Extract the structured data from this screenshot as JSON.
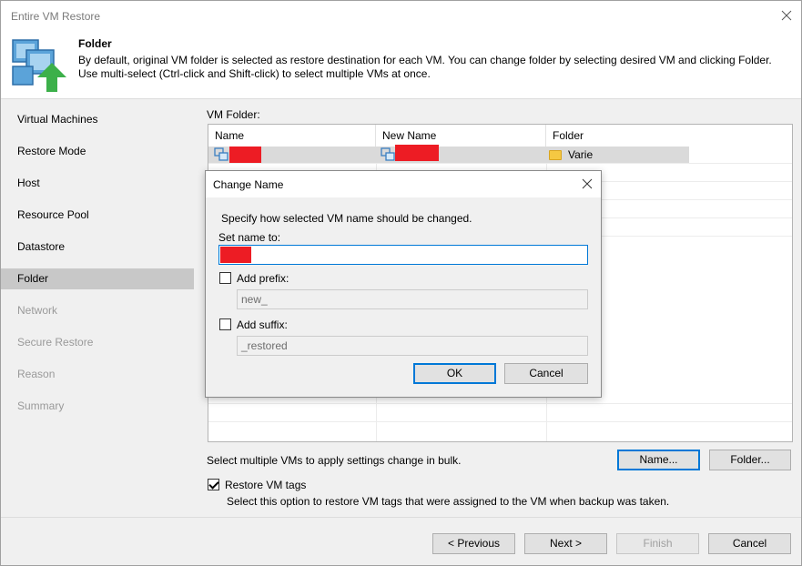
{
  "window": {
    "title": "Entire VM Restore"
  },
  "header": {
    "title": "Folder",
    "description": "By default, original VM folder is selected as restore destination for each VM. You can change folder by selecting desired VM and clicking Folder. Use multi-select (Ctrl-click and Shift-click) to select multiple VMs at once."
  },
  "sidebar": {
    "items": [
      {
        "label": "Virtual Machines",
        "state": "enabled"
      },
      {
        "label": "Restore Mode",
        "state": "enabled"
      },
      {
        "label": "Host",
        "state": "enabled"
      },
      {
        "label": "Resource Pool",
        "state": "enabled"
      },
      {
        "label": "Datastore",
        "state": "enabled"
      },
      {
        "label": "Folder",
        "state": "active"
      },
      {
        "label": "Network",
        "state": "disabled"
      },
      {
        "label": "Secure Restore",
        "state": "disabled"
      },
      {
        "label": "Reason",
        "state": "disabled"
      },
      {
        "label": "Summary",
        "state": "disabled"
      }
    ]
  },
  "content": {
    "vm_folder_label": "VM Folder:",
    "columns": [
      "Name",
      "New Name",
      "Folder"
    ],
    "rows": [
      {
        "name": "",
        "new_name": "",
        "folder": "Varie"
      }
    ],
    "bulk_hint": "Select multiple VMs to apply settings change in bulk.",
    "name_button": "Name...",
    "folder_button": "Folder...",
    "restore_tags_label": "Restore VM tags",
    "restore_tags_checked": true,
    "restore_tags_hint": "Select this option to restore VM tags that were assigned to the VM when backup was taken."
  },
  "dialog": {
    "title": "Change Name",
    "instruction": "Specify how selected VM name should be changed.",
    "set_name_label": "Set name to:",
    "set_name_value": "",
    "prefix_label": "Add prefix:",
    "prefix_checked": false,
    "prefix_value": "new_",
    "suffix_label": "Add suffix:",
    "suffix_checked": false,
    "suffix_value": "_restored",
    "ok_label": "OK",
    "cancel_label": "Cancel"
  },
  "footer": {
    "previous": "< Previous",
    "next": "Next >",
    "finish": "Finish",
    "cancel": "Cancel"
  },
  "colors": {
    "accent": "#0078d7",
    "redaction": "#ed1c24",
    "active_nav": "#c8c8c8",
    "vm_icon": "#3a7fc1",
    "logo_arrow": "#3cb04a"
  },
  "icons": {
    "logo": "vm-restore-logo-icon",
    "close": "close-icon",
    "vm": "vm-icon",
    "folder": "folder-icon"
  }
}
